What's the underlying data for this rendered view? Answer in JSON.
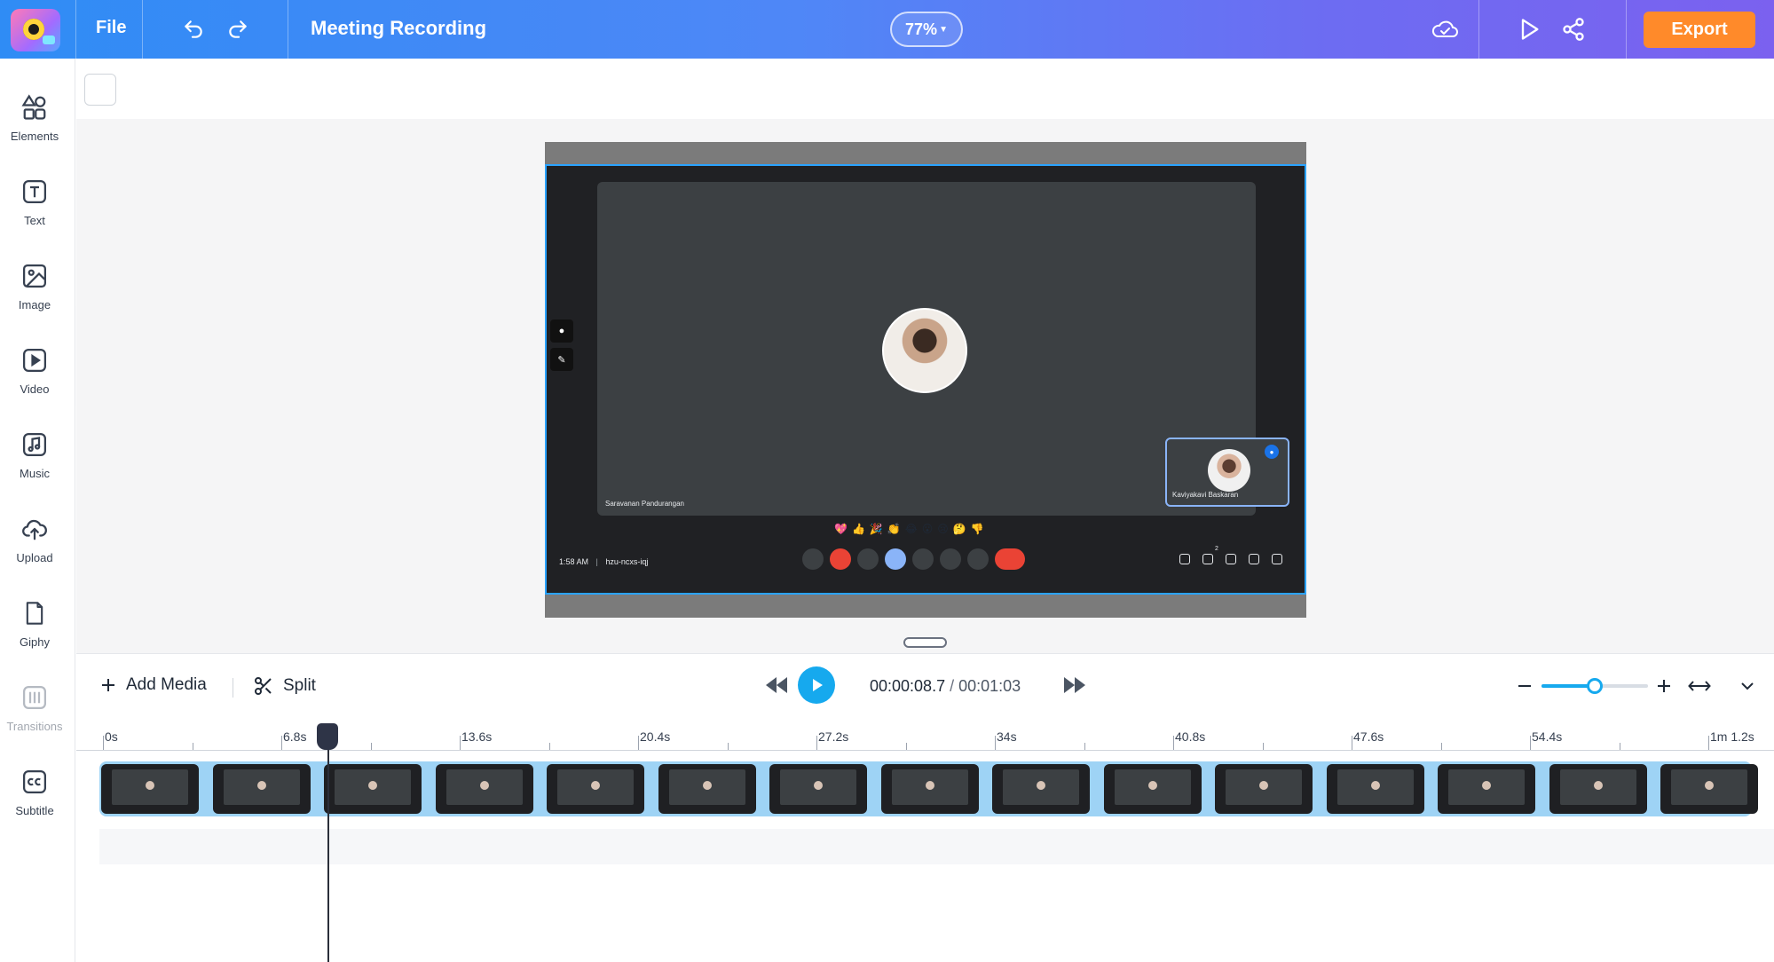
{
  "app": {
    "file_menu": "File",
    "project_title": "Meeting Recording",
    "zoom_level": "77%",
    "export_label": "Export",
    "accent_color": "#16a9ee",
    "export_color": "#ff8a2a"
  },
  "sidebar": {
    "items": [
      {
        "label": "Elements",
        "icon": "shapes-icon"
      },
      {
        "label": "Text",
        "icon": "text-icon"
      },
      {
        "label": "Image",
        "icon": "image-icon"
      },
      {
        "label": "Video",
        "icon": "video-icon"
      },
      {
        "label": "Music",
        "icon": "music-icon"
      },
      {
        "label": "Upload",
        "icon": "upload-cloud-icon"
      },
      {
        "label": "Giphy",
        "icon": "giphy-icon"
      },
      {
        "label": "Transitions",
        "icon": "transitions-icon"
      },
      {
        "label": "Subtitle",
        "icon": "cc-icon"
      }
    ]
  },
  "meeting": {
    "main_participant": "Saravanan Pandurangan",
    "pip_participant": "Kaviyakavi Baskaran",
    "time": "1:58 AM",
    "meeting_code": "hzu-ncxs-iqj",
    "reactions": "💖👍🎉👏😂😮😢🤔👎",
    "participant_count": "2"
  },
  "timeline": {
    "add_media_label": "Add Media",
    "split_label": "Split",
    "current_time": "00:00:08.7",
    "separator": " / ",
    "total_time": "00:01:03",
    "zoom_fraction": 0.5,
    "ruler_labels": [
      "0s",
      "6.8s",
      "13.6s",
      "20.4s",
      "27.2s",
      "34s",
      "40.8s",
      "47.6s",
      "54.4s",
      "1m 1.2s"
    ]
  }
}
